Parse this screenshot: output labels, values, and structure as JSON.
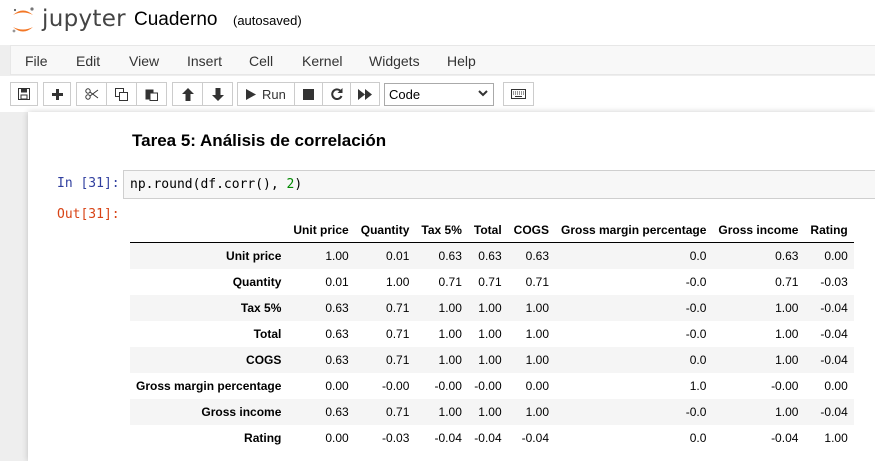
{
  "header": {
    "logo_text": "jupyter",
    "notebook_name": "Cuaderno",
    "save_status": "(autosaved)"
  },
  "menu": [
    "File",
    "Edit",
    "View",
    "Insert",
    "Cell",
    "Kernel",
    "Widgets",
    "Help"
  ],
  "toolbar": {
    "run_label": "Run",
    "cell_type": "Code",
    "icons": [
      "save-icon",
      "plus-icon",
      "cut-icon",
      "copy-icon",
      "paste-icon",
      "arrow-up-icon",
      "arrow-down-icon",
      "play-icon",
      "stop-icon",
      "restart-icon",
      "fast-forward-icon",
      "keyboard-icon"
    ]
  },
  "cells": {
    "markdown_title": "Tarea 5: Análisis de correlación",
    "in_prompt": "In [31]:",
    "code_prefix": "np.round(df.corr(), ",
    "code_num": "2",
    "code_suffix": ")",
    "out_prompt": "Out[31]:"
  },
  "dataframe": {
    "columns": [
      "Unit price",
      "Quantity",
      "Tax 5%",
      "Total",
      "COGS",
      "Gross margin percentage",
      "Gross income",
      "Rating"
    ],
    "rows": [
      {
        "label": "Unit price",
        "values": [
          "1.00",
          "0.01",
          "0.63",
          "0.63",
          "0.63",
          "0.0",
          "0.63",
          "0.00"
        ]
      },
      {
        "label": "Quantity",
        "values": [
          "0.01",
          "1.00",
          "0.71",
          "0.71",
          "0.71",
          "-0.0",
          "0.71",
          "-0.03"
        ]
      },
      {
        "label": "Tax 5%",
        "values": [
          "0.63",
          "0.71",
          "1.00",
          "1.00",
          "1.00",
          "-0.0",
          "1.00",
          "-0.04"
        ]
      },
      {
        "label": "Total",
        "values": [
          "0.63",
          "0.71",
          "1.00",
          "1.00",
          "1.00",
          "-0.0",
          "1.00",
          "-0.04"
        ]
      },
      {
        "label": "COGS",
        "values": [
          "0.63",
          "0.71",
          "1.00",
          "1.00",
          "1.00",
          "0.0",
          "1.00",
          "-0.04"
        ]
      },
      {
        "label": "Gross margin percentage",
        "values": [
          "0.00",
          "-0.00",
          "-0.00",
          "-0.00",
          "0.00",
          "1.0",
          "-0.00",
          "0.00"
        ]
      },
      {
        "label": "Gross income",
        "values": [
          "0.63",
          "0.71",
          "1.00",
          "1.00",
          "1.00",
          "-0.0",
          "1.00",
          "-0.04"
        ]
      },
      {
        "label": "Rating",
        "values": [
          "0.00",
          "-0.03",
          "-0.04",
          "-0.04",
          "-0.04",
          "0.0",
          "-0.04",
          "1.00"
        ]
      }
    ]
  }
}
